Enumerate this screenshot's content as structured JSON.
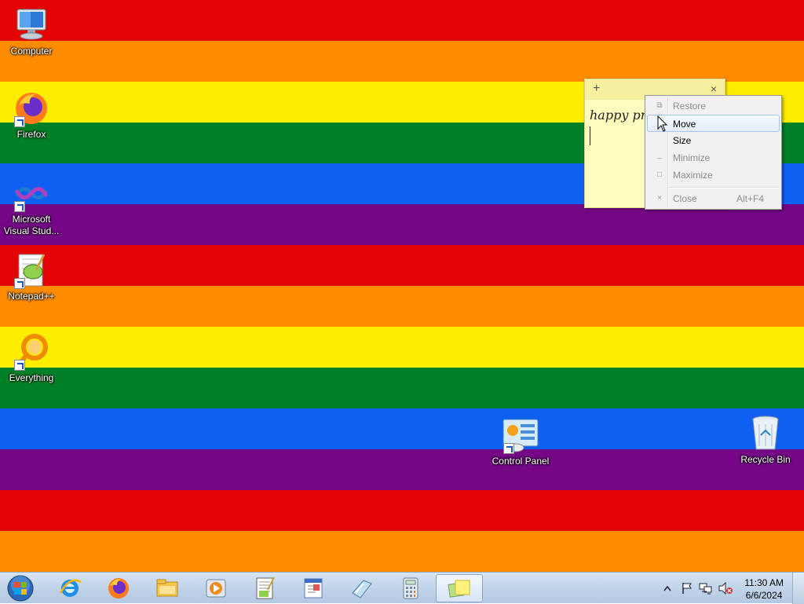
{
  "desktop": {
    "stripe_colors": [
      "#e40303",
      "#ff8c00",
      "#ffed00",
      "#008026",
      "#0f60f0",
      "#750787"
    ],
    "icons": [
      {
        "label": "Computer",
        "icon": "computer-icon"
      },
      {
        "label": "Firefox",
        "icon": "firefox-icon"
      },
      {
        "label": "Microsoft Visual Stud...",
        "icon": "visual-studio-icon"
      },
      {
        "label": "Notepad++",
        "icon": "notepad-plus-plus-icon"
      },
      {
        "label": "Everything",
        "icon": "everything-search-icon"
      },
      {
        "label": "Control Panel",
        "icon": "control-panel-icon"
      },
      {
        "label": "Recycle Bin",
        "icon": "recycle-bin-icon"
      }
    ]
  },
  "sticky_note": {
    "add_label": "+",
    "close_label": "×",
    "text": "happy pr"
  },
  "context_menu": {
    "items": [
      {
        "label": "Restore",
        "enabled": false,
        "icon": "restore-icon",
        "glyph": "⧉"
      },
      {
        "label": "Move",
        "enabled": true,
        "highlighted": true
      },
      {
        "label": "Size",
        "enabled": true
      },
      {
        "label": "Minimize",
        "enabled": false,
        "icon": "minimize-icon",
        "glyph": "_"
      },
      {
        "label": "Maximize",
        "enabled": false,
        "icon": "maximize-icon",
        "glyph": "□"
      },
      {
        "label": "Close",
        "enabled": false,
        "icon": "close-icon",
        "glyph": "×",
        "accelerator": "Alt+F4"
      }
    ]
  },
  "taskbar": {
    "pinned": [
      {
        "icon": "start-orb-icon"
      },
      {
        "icon": "internet-explorer-icon"
      },
      {
        "icon": "firefox-icon"
      },
      {
        "icon": "windows-explorer-icon"
      },
      {
        "icon": "media-player-icon"
      },
      {
        "icon": "notepad-plus-plus-icon"
      },
      {
        "icon": "wordpad-icon"
      },
      {
        "icon": "snipping-tool-icon"
      },
      {
        "icon": "calculator-icon"
      },
      {
        "icon": "sticky-notes-icon",
        "active": true
      }
    ],
    "tray": {
      "time": "11:30 AM",
      "date": "6/6/2024"
    }
  }
}
